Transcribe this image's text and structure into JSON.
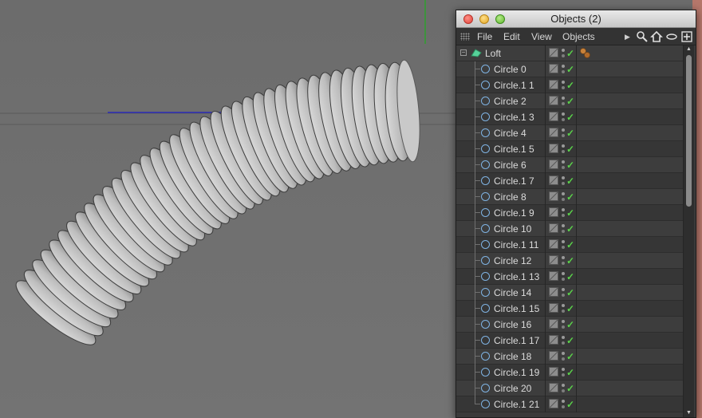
{
  "window": {
    "title": "Objects (2)"
  },
  "menu": {
    "file": "File",
    "edit": "Edit",
    "view": "View",
    "objects": "Objects"
  },
  "loft": {
    "name": "Loft",
    "check": "✓"
  },
  "circles": [
    "Circle 0",
    "Circle.1 1",
    "Circle 2",
    "Circle.1 3",
    "Circle 4",
    "Circle.1 5",
    "Circle 6",
    "Circle.1 7",
    "Circle 8",
    "Circle.1 9",
    "Circle 10",
    "Circle.1 11",
    "Circle 12",
    "Circle.1 13",
    "Circle 14",
    "Circle.1 15",
    "Circle 16",
    "Circle.1 17",
    "Circle 18",
    "Circle.1 19",
    "Circle 20",
    "Circle.1 21"
  ],
  "check_glyph": "✓",
  "colors": {
    "viewport_bg": "#6f6f6f",
    "hose_light": "#d8d8d8",
    "hose_dark": "#4a4a4a",
    "circle_icon": "#7fb3e3",
    "check": "#5ad14a"
  },
  "icons": {
    "tool": [
      "search-icon",
      "home-icon",
      "eye-icon",
      "new-panel-icon"
    ],
    "row": [
      "circle-spline-icon",
      "visibility-icon",
      "check-icon"
    ]
  }
}
